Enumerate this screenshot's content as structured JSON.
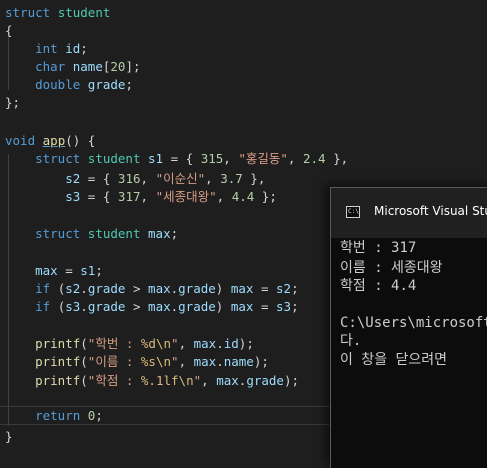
{
  "code": {
    "struct_kw": "struct",
    "type_name": "student",
    "open_brace": "{",
    "close_brace_semi": "};",
    "close_brace": "}",
    "field_int": "int",
    "field_id": "id",
    "field_char": "char",
    "field_name": "name",
    "field_name_size": "20",
    "field_double": "double",
    "field_grade": "grade",
    "void_kw": "void",
    "fn_name": "app",
    "var_s1": "s1",
    "var_s2": "s2",
    "var_s3": "s3",
    "var_max": "max",
    "s1_num": "315",
    "s1_name": "\"홍길동\"",
    "s1_grade": "2.4",
    "s2_num": "316",
    "s2_name": "\"이순신\"",
    "s2_grade": "3.7",
    "s3_num": "317",
    "s3_name": "\"세종대왕\"",
    "s3_grade": "4.4",
    "if_kw": "if",
    "printf": "printf",
    "fmt1_a": "\"학번 : ",
    "fmt1_spec": "%d",
    "fmt2_a": "\"이름 : ",
    "fmt2_spec": "%s",
    "fmt3_a": "\"학점 : ",
    "fmt3_spec": "%.1lf",
    "newline_esc": "\\n",
    "quote": "\"",
    "return_kw": "return",
    "zero": "0"
  },
  "console": {
    "title": "Microsoft Visual Studio",
    "icon_text": "C:\\",
    "lines": [
      "학번 : 317",
      "이름 : 세종대왕",
      "학점 : 4.4",
      "",
      "C:\\Users\\microsoft",
      "다.",
      "이 창을 닫으려면"
    ]
  }
}
